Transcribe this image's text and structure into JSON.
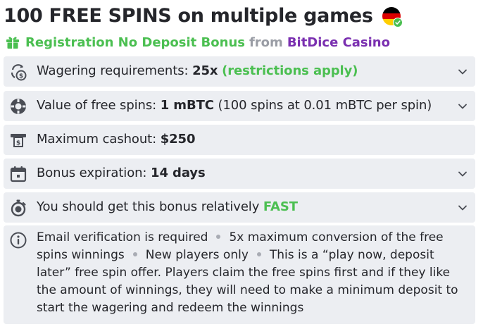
{
  "header": {
    "title": "100 FREE SPINS on multiple games",
    "flag_colors": [
      "#000000",
      "#dd0000",
      "#ffce00"
    ]
  },
  "subtitle": {
    "bonus_type": "Registration No Deposit Bonus",
    "from_label": "from",
    "casino": "BitDice Casino"
  },
  "colors": {
    "accent_green": "#4bbf51",
    "casino_purple": "#7a2fb0",
    "row_bg": "#eceef2",
    "text": "#25262b"
  },
  "details": {
    "wagering": {
      "icon": "wagering-icon",
      "label": "Wagering requirements:",
      "value": "25x",
      "extra": "(restrictions apply)"
    },
    "spin_value": {
      "icon": "spin-chip-icon",
      "label": "Value of free spins:",
      "value": "1 mBTC",
      "extra": "(100 spins at 0.01 mBTC per spin)"
    },
    "cashout": {
      "icon": "cashout-icon",
      "label": "Maximum cashout:",
      "value": "$250"
    },
    "expiration": {
      "icon": "calendar-icon",
      "label": "Bonus expiration:",
      "value": "14 days"
    },
    "speed": {
      "icon": "stopwatch-icon",
      "label": "You should get this bonus relatively",
      "value": "FAST"
    }
  },
  "notes": {
    "icon": "info-icon",
    "items": [
      "Email verification is required",
      "5x maximum conversion of the free spins winnings",
      "New players only",
      "This is a “play now, deposit later” free spin offer. Players claim the free spins first and if they like the amount of winnings, they will need to make a minimum deposit to start the wagering and redeem the winnings"
    ]
  }
}
